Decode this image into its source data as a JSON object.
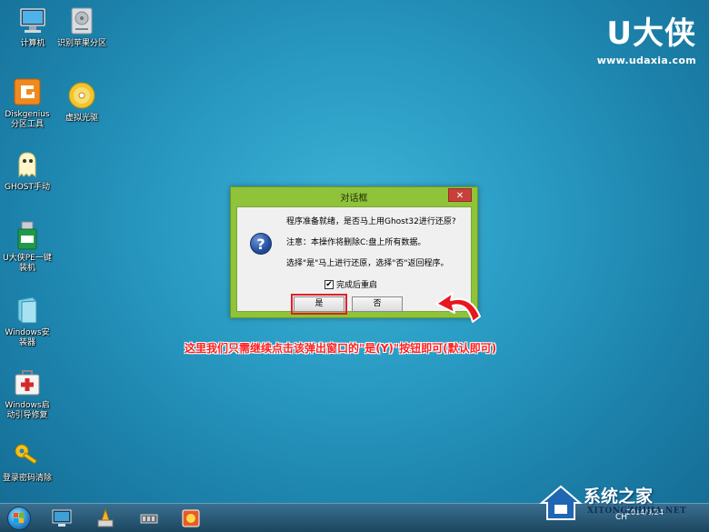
{
  "desktop": {
    "icons": [
      {
        "label": "计算机"
      },
      {
        "label": "识别苹果分区"
      },
      {
        "label": "Diskgenius\n分区工具"
      },
      {
        "label": "虚拟光驱"
      },
      {
        "label": "GHOST手动"
      },
      {
        "label": "U大侠PE一键\n装机"
      },
      {
        "label": "Windows安\n装器"
      },
      {
        "label": "Windows启\n动引导修复"
      },
      {
        "label": "登录密码清除"
      }
    ]
  },
  "brand": {
    "logo": "U大侠",
    "url": "www.udaxia.com"
  },
  "dialog": {
    "title": "对话框",
    "close_label": "✕",
    "line1": "程序准备就绪，是否马上用Ghost32进行还原?",
    "line2": "注意：本操作将删除C:盘上所有数据。",
    "line3": "选择\"是\"马上进行还原，选择\"否\"返回程序。",
    "checkbox_label": "完成后重启",
    "checkbox_checked": true,
    "yes_label": "是",
    "no_label": "否"
  },
  "annotation": {
    "text": "这里我们只需继续点击该弹出窗口的\"是(Y)\"按钮即可(默认即可)",
    "color": "#ff2020"
  },
  "taskbar": {
    "tray_text": "CH",
    "clock": "2014/9/24"
  },
  "watermark": {
    "title": "系统之家",
    "subtitle": "XITONGZHIJIA.NET"
  },
  "colors": {
    "dialog_frame": "#8fc33a",
    "close_button": "#c7413a",
    "highlight": "#e0202a"
  }
}
